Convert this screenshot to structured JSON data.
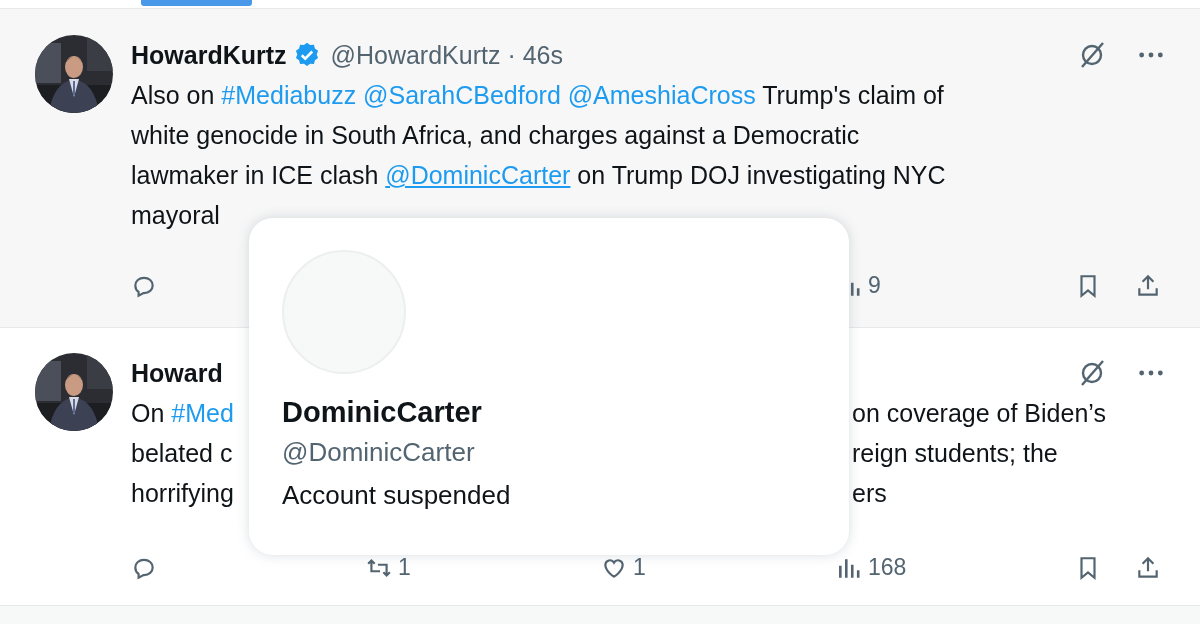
{
  "tweets": [
    {
      "hovered": true,
      "name": "HowardKurtz",
      "verified": true,
      "meta": "@HowardKurtz · 46s",
      "lines": [
        {
          "left": [
            {
              "kind": "text",
              "text": "Also on "
            },
            {
              "kind": "tag",
              "text": "#Mediabuzz @SarahCBedford @AmeshiaCross"
            },
            {
              "kind": "text",
              "text": " Trump's claim of"
            }
          ]
        },
        {
          "left": [
            {
              "kind": "text",
              "text": "white genocide in South Africa, and charges against a Democratic"
            }
          ]
        },
        {
          "left": [
            {
              "kind": "text",
              "text": "lawmaker in ICE clash "
            },
            {
              "kind": "link",
              "text": "@DominicCarter"
            },
            {
              "kind": "text",
              "text": " on Trump DOJ investigating NYC"
            }
          ]
        },
        {
          "left": [
            {
              "kind": "text",
              "text": "mayoral"
            }
          ]
        }
      ],
      "actions": [
        {
          "kind": "reply"
        },
        {
          "kind": "views",
          "count": "9"
        },
        {
          "kind": "bookmark"
        },
        {
          "kind": "share"
        }
      ]
    },
    {
      "hovered": false,
      "name": "Howard",
      "verified": false,
      "lines": [
        {
          "left": [
            {
              "kind": "text",
              "text": "On "
            },
            {
              "kind": "tag",
              "text": "#Med"
            }
          ],
          "right": [
            {
              "kind": "text",
              "text": "on coverage of Biden’s"
            }
          ]
        },
        {
          "left": [
            {
              "kind": "text",
              "text": "belated c"
            }
          ],
          "right": [
            {
              "kind": "text",
              "text": "reign students; the"
            }
          ]
        },
        {
          "left": [
            {
              "kind": "text",
              "text": "horrifying"
            }
          ],
          "right": [
            {
              "kind": "text",
              "text": "ers"
            }
          ]
        }
      ],
      "actions": [
        {
          "kind": "reply"
        },
        {
          "kind": "retweet",
          "count": "1"
        },
        {
          "kind": "like",
          "count": "1"
        },
        {
          "kind": "views",
          "count": "168"
        },
        {
          "kind": "bookmark"
        },
        {
          "kind": "share"
        }
      ]
    }
  ],
  "popup": {
    "name": "DominicCarter",
    "handle": "@DominicCarter",
    "status": "Account suspended"
  }
}
